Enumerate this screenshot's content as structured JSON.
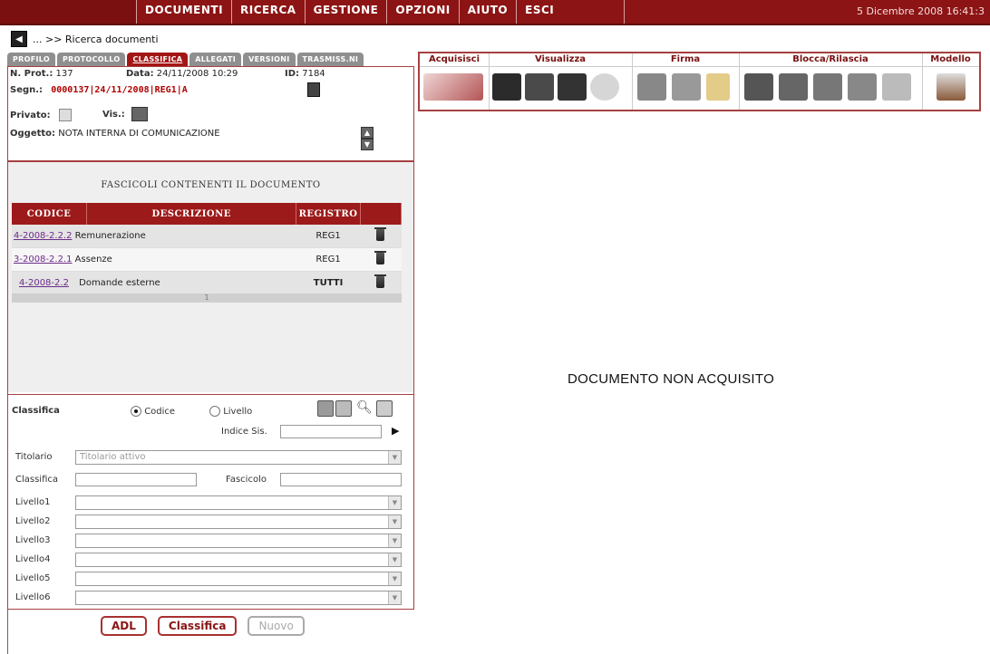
{
  "topbar": {
    "menu": [
      "DOCUMENTI",
      "RICERCA",
      "GESTIONE",
      "OPZIONI",
      "AIUTO",
      "ESCI"
    ],
    "date": "5 Dicembre 2008 16:41:3"
  },
  "breadcrumb": {
    "text": "... >> Ricerca documenti"
  },
  "tabs": [
    "PROFILO",
    "PROTOCOLLO",
    "CLASSIFICA",
    "ALLEGATI",
    "VERSIONI",
    "TRASMISS.NI"
  ],
  "active_tab": "CLASSIFICA",
  "doc": {
    "nprot_label": "N. Prot.:",
    "nprot": "137",
    "data_label": "Data:",
    "data": "24/11/2008 10:29",
    "id_label": "ID:",
    "id": "7184",
    "segn_label": "Segn.:",
    "segn": "0000137|24/11/2008|REG1|A",
    "privato_label": "Privato:",
    "vis_label": "Vis.:",
    "oggetto_label": "Oggetto:",
    "oggetto": "NOTA INTERNA DI COMUNICAZIONE"
  },
  "fascicoli": {
    "title": "FASCICOLI CONTENENTI IL DOCUMENTO",
    "headers": [
      "CODICE",
      "DESCRIZIONE",
      "REGISTRO"
    ],
    "rows": [
      {
        "codice": "4-2008-2.2.2",
        "descrizione": "Remunerazione",
        "registro": "REG1"
      },
      {
        "codice": "3-2008-2.2.1",
        "descrizione": "Assenze",
        "registro": "REG1"
      },
      {
        "codice": "4-2008-2.2",
        "descrizione": "Domande esterne",
        "registro": "TUTTI"
      }
    ],
    "page": "1"
  },
  "classifica": {
    "label": "Classifica",
    "radio_codice": "Codice",
    "radio_livello": "Livello",
    "indice_label": "Indice Sis.",
    "titolario_label": "Titolario",
    "titolario_value": "Titolario attivo",
    "classifica_label": "Classifica",
    "fascicolo_label": "Fascicolo",
    "livelli": [
      "Livello1",
      "Livello2",
      "Livello3",
      "Livello4",
      "Livello5",
      "Livello6"
    ]
  },
  "buttons": {
    "adl": "ADL",
    "classifica": "Classifica",
    "nuovo": "Nuovo"
  },
  "toolbar_groups": [
    "Acquisisci",
    "Visualizza",
    "Firma",
    "Blocca/Rilascia",
    "Modello"
  ],
  "notice": "DOCUMENTO NON ACQUISITO",
  "colors": {
    "brand": "#8c1414",
    "tab_active": "#a31616",
    "link": "#6b2c8a"
  }
}
